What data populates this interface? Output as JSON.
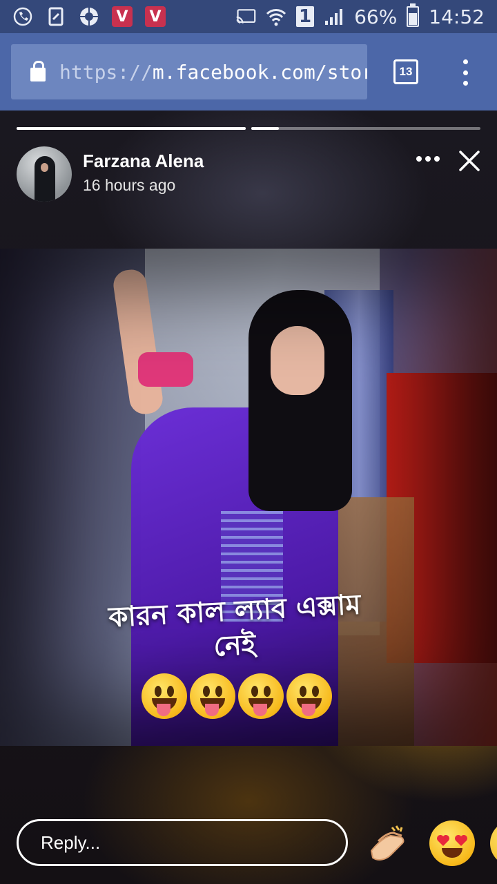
{
  "status_bar": {
    "battery": "66%",
    "battery_level": 0.66,
    "time": "14:52",
    "sim": "1",
    "icons": [
      "phone-icon",
      "sim-card-icon",
      "camera-aperture-icon",
      "vidmate-icon",
      "vidmate-icon",
      "cast-icon",
      "wifi-icon",
      "signal-icon",
      "battery-icon"
    ],
    "badge_v": "V"
  },
  "browser": {
    "url_scheme": "https://",
    "url_rest": "m.facebook.com/stories",
    "tab_count": "13"
  },
  "story": {
    "progress": [
      1.0,
      0.12
    ],
    "author": "Farzana Alena",
    "time_ago": "16 hours ago",
    "caption_line1": "কারন কাল ল্যাব এক্সাম",
    "caption_line2": "নেই",
    "emoji_count": 4,
    "emoji": "tongue-out-face",
    "reply_placeholder": "Reply...",
    "reactions": [
      "clapping-hands",
      "heart-eyes-face",
      "face"
    ]
  }
}
